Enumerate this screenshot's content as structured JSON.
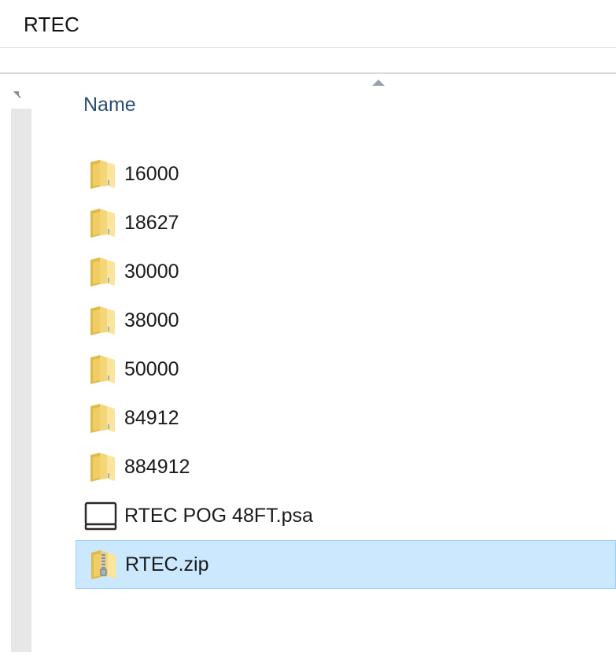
{
  "window": {
    "title": "RTEC"
  },
  "list_header": {
    "name_label": "Name",
    "sort": "ascending"
  },
  "files": [
    {
      "name": "16000",
      "type": "folder",
      "icon": "folder-icon",
      "selected": false
    },
    {
      "name": "18627",
      "type": "folder",
      "icon": "folder-icon",
      "selected": false
    },
    {
      "name": "30000",
      "type": "folder",
      "icon": "folder-icon",
      "selected": false
    },
    {
      "name": "38000",
      "type": "folder",
      "icon": "folder-icon",
      "selected": false
    },
    {
      "name": "50000",
      "type": "folder",
      "icon": "folder-icon",
      "selected": false
    },
    {
      "name": "84912",
      "type": "folder",
      "icon": "folder-icon",
      "selected": false
    },
    {
      "name": "884912",
      "type": "folder",
      "icon": "folder-icon",
      "selected": false
    },
    {
      "name": "RTEC POG 48FT.psa",
      "type": "file",
      "icon": "monitor-file-icon",
      "selected": false
    },
    {
      "name": "RTEC.zip",
      "type": "zip",
      "icon": "zip-folder-icon",
      "selected": true
    }
  ],
  "colors": {
    "selection_fill": "#cce8ff",
    "selection_border": "#99d1ff",
    "header_text": "#2b4d77",
    "folder_yellow": "#f5d677"
  }
}
